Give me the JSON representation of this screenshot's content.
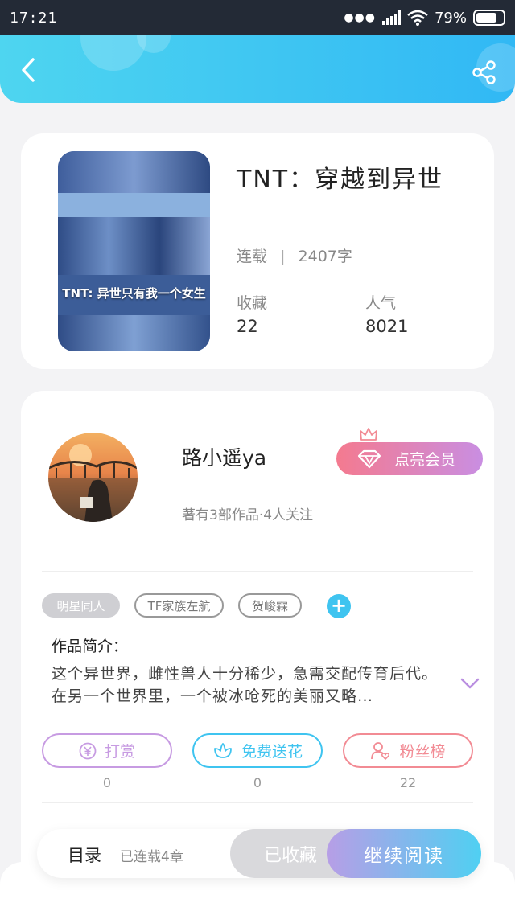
{
  "status_bar": {
    "time": "17:21",
    "battery": "79%",
    "battery_level": 0.79
  },
  "book": {
    "title": "TNT：穿越到异世",
    "cover_caption": "TNT: 异世只有我一个女生",
    "status": "连载",
    "word_count": "2407字",
    "stats": [
      {
        "label": "收藏",
        "value": "22"
      },
      {
        "label": "人气",
        "value": "8021"
      }
    ]
  },
  "author": {
    "name": "路小遥ya",
    "subtitle": "著有3部作品·4人关注",
    "vip_label": "点亮会员"
  },
  "tags": [
    {
      "label": "明星同人",
      "style": "filled"
    },
    {
      "label": "TF家族左航",
      "style": "outline"
    },
    {
      "label": "贺峻霖",
      "style": "outline"
    }
  ],
  "intro": {
    "title": "作品简介：",
    "text": "这个异世界，雌性兽人十分稀少，急需交配传育后代。在另一个世界里，一个被冰呛死的美丽又略…"
  },
  "actions": [
    {
      "label": "打赏",
      "count": "0",
      "color": "#c79be2",
      "icon": "yuan-icon"
    },
    {
      "label": "免费送花",
      "count": "0",
      "color": "#3fc4f0",
      "icon": "flower-icon"
    },
    {
      "label": "粉丝榜",
      "count": "22",
      "color": "#f28b94",
      "icon": "fan-icon"
    }
  ],
  "bottom_bar": {
    "toc_label": "目录",
    "toc_sub": "已连载4章",
    "collected_label": "已收藏",
    "read_label": "继续阅读"
  },
  "colors": {
    "accent": "#3fc4f0",
    "header": "#31b8f4",
    "status_bar": "#232a36"
  }
}
